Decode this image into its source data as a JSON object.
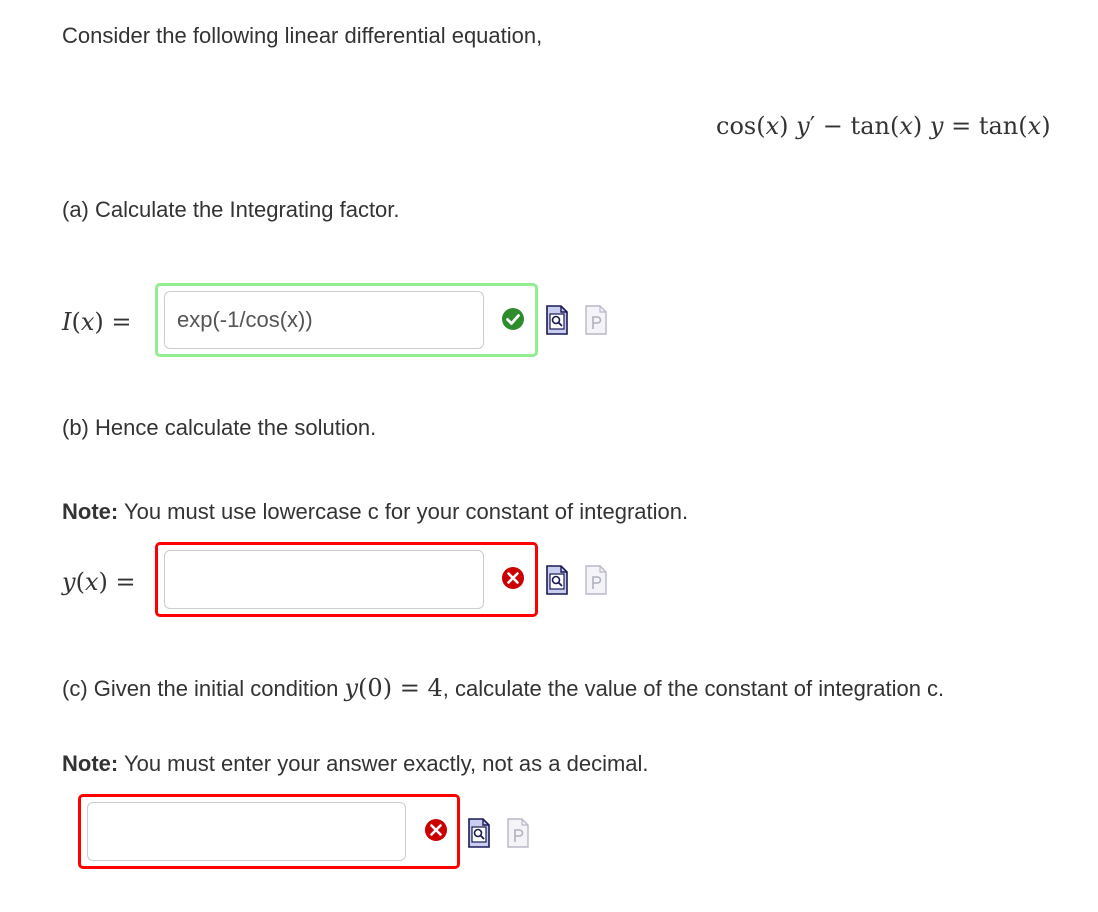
{
  "intro": "Consider the following linear differential equation,",
  "equation": {
    "lhs_fn1": "cos",
    "lhs_var1": "x",
    "lhs_y1": "y",
    "prime": "′",
    "minus": "−",
    "lhs_fn2": "tan",
    "lhs_var2": "x",
    "lhs_y2": "y",
    "equals": "=",
    "rhs_fn": "tan",
    "rhs_var": "x"
  },
  "part_a": {
    "prompt": "(a) Calculate the Integrating factor.",
    "label_fn": "I",
    "label_var": "x",
    "equals": "=",
    "answer_value": "exp(-1/cos(x))",
    "status": "correct"
  },
  "part_b": {
    "prompt": "(b) Hence calculate the solution.",
    "note_bold": "Note:",
    "note_text": "You must use lowercase c for your constant of integration.",
    "label_fn": "y",
    "label_var": "x",
    "equals": "=",
    "answer_value": "",
    "status": "incorrect"
  },
  "part_c": {
    "prompt_before": "(c) Given the initial condition",
    "condition_fn": "y",
    "condition_arg": "0",
    "condition_equals": "=",
    "condition_value": "4",
    "prompt_after": ", calculate the value of the constant of integration c.",
    "note_bold": "Note:",
    "note_text": "You must enter your answer exactly, not as a decimal.",
    "answer_value": "",
    "status": "incorrect"
  },
  "icons": {
    "correct": "check-circle-icon",
    "incorrect": "x-circle-icon",
    "preview": "preview-document-icon",
    "paper": "paper-document-icon"
  },
  "colors": {
    "correct_border": "#90ee90",
    "incorrect_border": "#ff0000",
    "correct_icon": "#2e8b2e",
    "incorrect_icon": "#cc0000",
    "text": "#333333"
  }
}
